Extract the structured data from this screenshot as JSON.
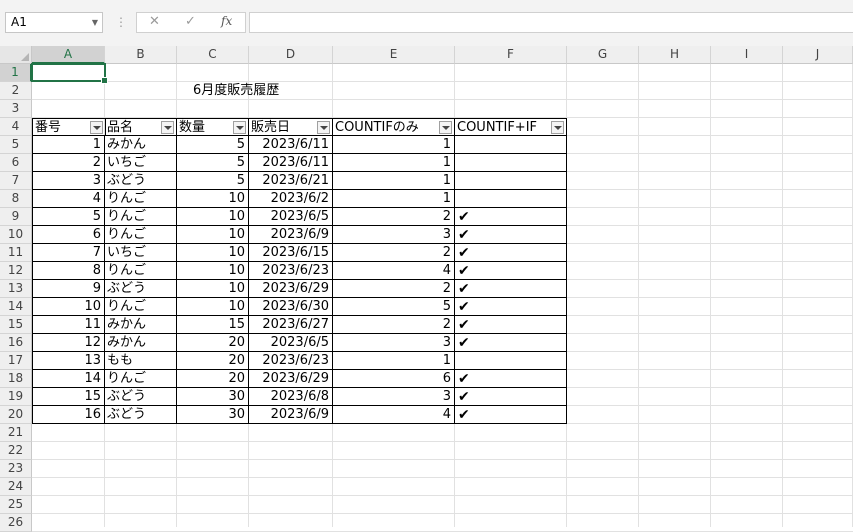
{
  "formula_bar": {
    "name_box": "A1",
    "cancel_icon": "✕",
    "enter_icon": "✓",
    "function_label": "fx",
    "formula": ""
  },
  "columns": [
    "A",
    "B",
    "C",
    "D",
    "E",
    "F",
    "G",
    "H",
    "I",
    "J"
  ],
  "rows": [
    "1",
    "2",
    "3",
    "4",
    "5",
    "6",
    "7",
    "8",
    "9",
    "10",
    "11",
    "12",
    "13",
    "14",
    "15",
    "16",
    "17",
    "18",
    "19",
    "20",
    "21",
    "22",
    "23",
    "24",
    "25",
    "26"
  ],
  "title": "6月度販売履歴",
  "table": {
    "headers": [
      "番号",
      "品名",
      "数量",
      "販売日",
      "COUNTIFのみ",
      "COUNTIF+IF"
    ],
    "rows": [
      [
        "1",
        "みかん",
        "5",
        "2023/6/11",
        "1",
        ""
      ],
      [
        "2",
        "いちご",
        "5",
        "2023/6/11",
        "1",
        ""
      ],
      [
        "3",
        "ぶどう",
        "5",
        "2023/6/21",
        "1",
        ""
      ],
      [
        "4",
        "りんご",
        "10",
        "2023/6/2",
        "1",
        ""
      ],
      [
        "5",
        "りんご",
        "10",
        "2023/6/5",
        "2",
        "✔"
      ],
      [
        "6",
        "りんご",
        "10",
        "2023/6/9",
        "3",
        "✔"
      ],
      [
        "7",
        "いちご",
        "10",
        "2023/6/15",
        "2",
        "✔"
      ],
      [
        "8",
        "りんご",
        "10",
        "2023/6/23",
        "4",
        "✔"
      ],
      [
        "9",
        "ぶどう",
        "10",
        "2023/6/29",
        "2",
        "✔"
      ],
      [
        "10",
        "りんご",
        "10",
        "2023/6/30",
        "5",
        "✔"
      ],
      [
        "11",
        "みかん",
        "15",
        "2023/6/27",
        "2",
        "✔"
      ],
      [
        "12",
        "みかん",
        "20",
        "2023/6/5",
        "3",
        "✔"
      ],
      [
        "13",
        "もも",
        "20",
        "2023/6/23",
        "1",
        ""
      ],
      [
        "14",
        "りんご",
        "20",
        "2023/6/29",
        "6",
        "✔"
      ],
      [
        "15",
        "ぶどう",
        "30",
        "2023/6/8",
        "3",
        "✔"
      ],
      [
        "16",
        "ぶどう",
        "30",
        "2023/6/9",
        "4",
        "✔"
      ]
    ]
  }
}
